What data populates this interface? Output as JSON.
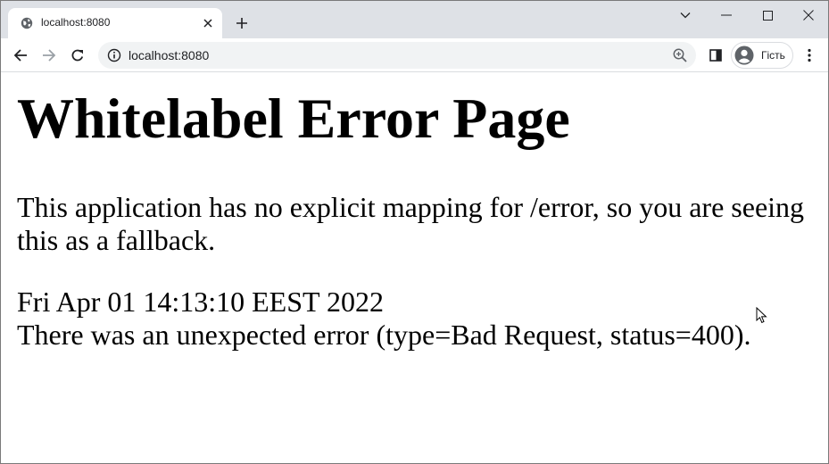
{
  "browser": {
    "tab": {
      "title": "localhost:8080",
      "favicon": "globe-icon"
    },
    "new_tab_icon": "plus-icon",
    "window_controls": [
      "chevron-down-icon",
      "minimize-icon",
      "maximize-icon",
      "close-icon"
    ],
    "toolbar": {
      "back_icon": "back-arrow-icon",
      "forward_icon": "forward-arrow-icon",
      "reload_icon": "reload-icon",
      "address": "localhost:8080",
      "site_info_icon": "info-icon",
      "zoom_icon": "zoom-in-icon",
      "side_panel_icon": "side-panel-icon",
      "profile_label": "Гість",
      "menu_icon": "kebab-menu-icon"
    }
  },
  "page": {
    "heading": "Whitelabel Error Page",
    "message_line1": "This application has no explicit mapping for /error, so you are seeing",
    "message_line2": "this as a fallback.",
    "timestamp": "Fri Apr 01 14:13:10 EEST 2022",
    "error_detail": "There was an unexpected error (type=Bad Request, status=400)."
  },
  "colors": {
    "tabstrip_bg": "#dee1e6",
    "omnibox_bg": "#f1f3f4",
    "icon_color": "#5f6368",
    "text_color": "#202124"
  }
}
